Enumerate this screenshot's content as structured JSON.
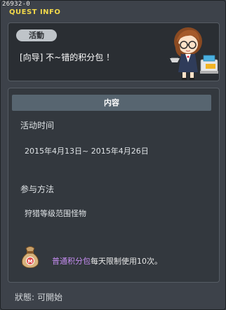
{
  "window": {
    "quest_id": "26932-0",
    "title": "QUEST INFO"
  },
  "quest": {
    "tag": "活動",
    "name": "[向导] 不~错的积分包 ！",
    "npc_icon": "npc-girl-with-glasses-icon"
  },
  "content": {
    "header": "内容",
    "period_label": "活动时间",
    "period_value": "2015年4月13日~ 2015年4月26日",
    "method_label": "参与方法",
    "method_value": "狩猎等级范围怪物",
    "reward_icon": "bag-icon",
    "reward_item": "普通积分包",
    "reward_suffix": "每天限制使用10次。"
  },
  "status": {
    "label": "狀態:",
    "value": "可開始"
  },
  "colors": {
    "title": "#f1d84a",
    "tag_bg": "#bfc4c9",
    "header_bg": "#576570",
    "reward_item": "#c48cf0"
  }
}
